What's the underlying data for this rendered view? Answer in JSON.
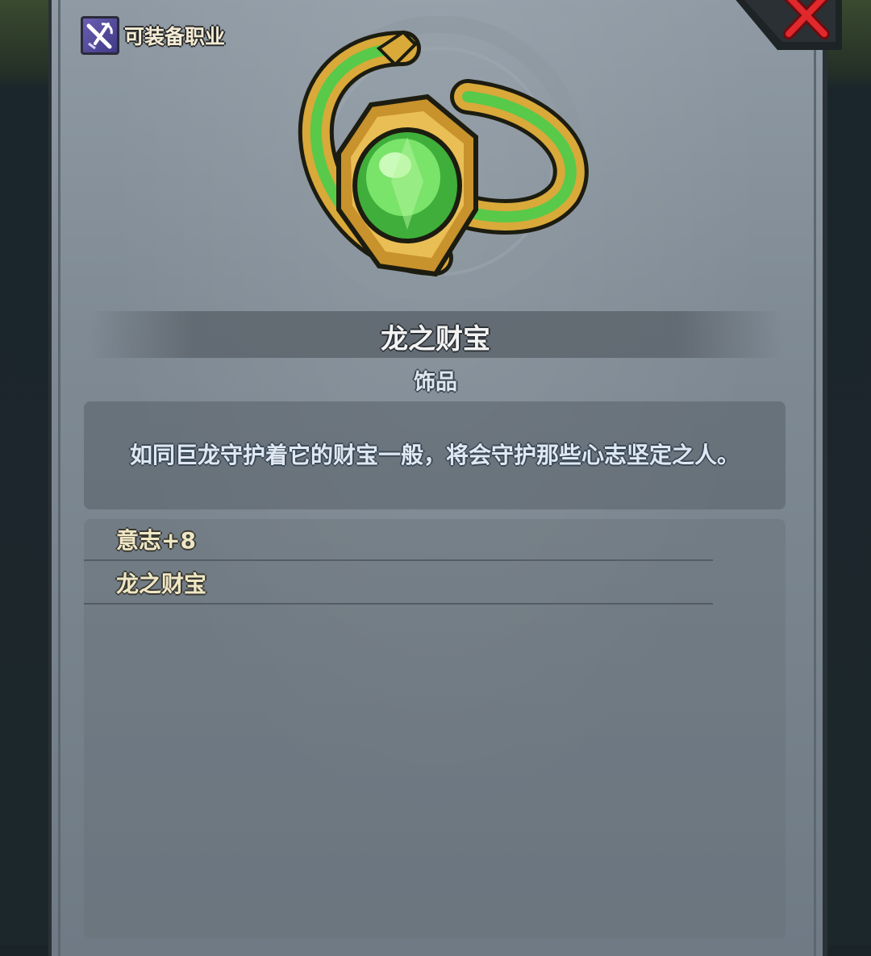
{
  "header": {
    "class_label": "可装备职业",
    "class_icon": "crossed-weapons-icon",
    "close_icon": "red-x-close-icon"
  },
  "item": {
    "image": "emerald-ring-icon",
    "name": "龙之财宝",
    "type": "饰品",
    "description": "如同巨龙守护着它的财宝一般，将会守护那些心志坚定之人。"
  },
  "stats": [
    {
      "text": "意志+8"
    },
    {
      "text": "龙之财宝"
    }
  ],
  "colors": {
    "panel": "#838e98",
    "name_text": "#f3f3f3",
    "stat_text": "#efe6c4",
    "close_x": "#e0282d",
    "gem_green": "#5fd65a",
    "ring_gold": "#d9a93a"
  }
}
